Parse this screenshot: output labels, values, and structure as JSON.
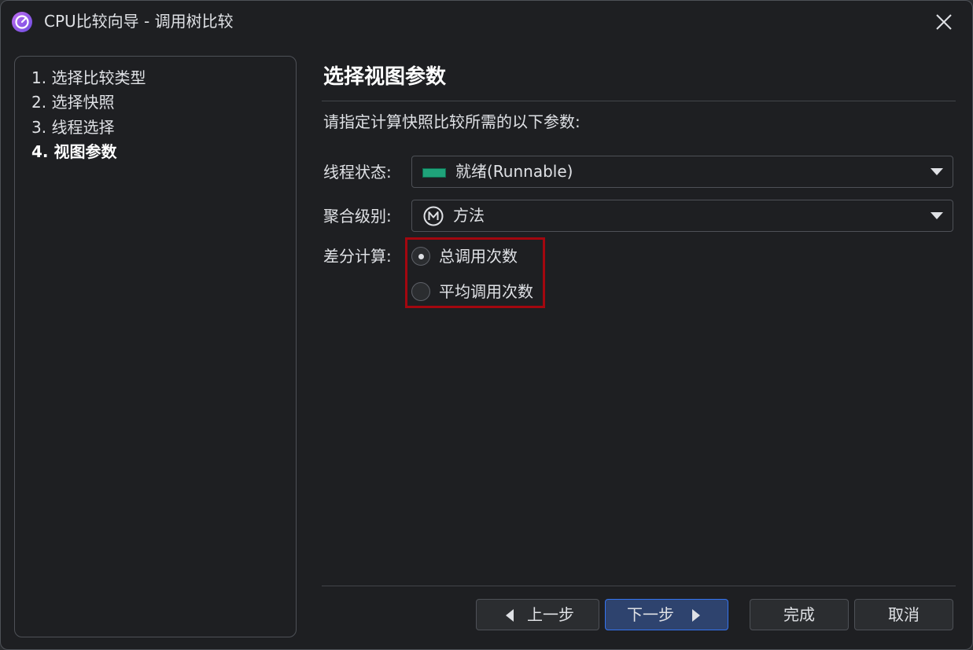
{
  "window": {
    "title": "CPU比较向导 - 调用树比较",
    "icon": "profiler-app-icon",
    "close_icon": "close-icon"
  },
  "steps": [
    {
      "label": "1. 选择比较类型",
      "current": false
    },
    {
      "label": "2. 选择快照",
      "current": false
    },
    {
      "label": "3. 线程选择",
      "current": false
    },
    {
      "label": "4. 视图参数",
      "current": true
    }
  ],
  "content": {
    "title": "选择视图参数",
    "description": "请指定计算快照比较所需的以下参数:"
  },
  "thread_state": {
    "label": "线程状态:",
    "value": "就绪(Runnable)",
    "swatch_color": "#1fa37a"
  },
  "aggregation": {
    "label": "聚合级别:",
    "value": "方法",
    "icon": "method-m-icon"
  },
  "diff": {
    "label": "差分计算:",
    "options": [
      {
        "label": "总调用次数",
        "selected": true
      },
      {
        "label": "平均调用次数",
        "selected": false
      }
    ],
    "highlight_color": "#a3070f"
  },
  "buttons": {
    "back": "上一步",
    "next": "下一步",
    "finish": "完成",
    "cancel": "取消"
  }
}
